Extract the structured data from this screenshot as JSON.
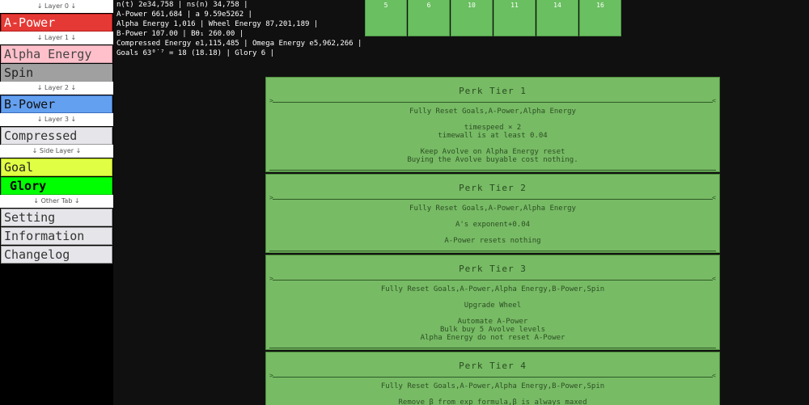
{
  "sidebar": {
    "items": [
      {
        "type": "sep",
        "label": "↓ Layer 0 ↓"
      },
      {
        "type": "tab",
        "label": "A-Power",
        "style": "red"
      },
      {
        "type": "sep",
        "label": "↓ Layer 1 ↓"
      },
      {
        "type": "tab",
        "label": "Alpha Energy",
        "style": "pink"
      },
      {
        "type": "tab",
        "label": "Spin",
        "style": "spin"
      },
      {
        "type": "sep",
        "label": "↓ Layer 2 ↓"
      },
      {
        "type": "tab",
        "label": "B-Power",
        "style": "blue"
      },
      {
        "type": "sep",
        "label": "↓ Layer 3 ↓"
      },
      {
        "type": "tab",
        "label": "Compressed",
        "style": "gray"
      },
      {
        "type": "sep",
        "label": "↓ Side Layer ↓"
      },
      {
        "type": "tab",
        "label": "Goal",
        "style": "yellow"
      },
      {
        "type": "tab",
        "label": "Glory",
        "style": "green"
      },
      {
        "type": "sep",
        "label": "↓ Other Tab ↓"
      },
      {
        "type": "tab",
        "label": "Setting",
        "style": "gray"
      },
      {
        "type": "tab",
        "label": "Information",
        "style": "gray"
      },
      {
        "type": "tab",
        "label": "Changelog",
        "style": "gray"
      }
    ]
  },
  "stats": [
    "n(t) 2e34,758 | ns(n) 34,758 |",
    "A-Power 661,684 | a 9.59e5262 |",
    "Alpha Energy 1,016 | Wheel Energy 87,201,189 |",
    "B-Power 107.00 | Bθ₁ 260.00 |",
    "Compressed Energy e1,115,485 | Omega Energy e5,962,266 |",
    "Goals 63⁰˙⁷ = 18 (18.18) | Glory 6 |"
  ],
  "top_boxes": [
    "5",
    "6",
    "10",
    "11",
    "14",
    "16"
  ],
  "perks": [
    {
      "title": "Perk Tier 1",
      "lines": [
        "Fully Reset Goals,A-Power,Alpha Energy",
        "",
        "timespeed × 2",
        "timewall is at least 0.04",
        "",
        "Keep Avolve on Alpha Energy reset",
        "Buying the Avolve buyable cost nothing."
      ]
    },
    {
      "title": "Perk Tier 2",
      "lines": [
        "Fully Reset Goals,A-Power,Alpha Energy",
        "",
        "A's exponent+0.04",
        "",
        "A-Power resets nothing"
      ]
    },
    {
      "title": "Perk Tier 3",
      "lines": [
        "Fully Reset Goals,A-Power,Alpha Energy,B-Power,Spin",
        "",
        "Upgrade Wheel",
        "",
        "Automate A-Power",
        "Bulk buy 5 Avolve levels",
        "Alpha Energy do not reset A-Power"
      ]
    },
    {
      "title": "Perk Tier 4",
      "lines": [
        "Fully Reset Goals,A-Power,Alpha Energy,B-Power,Spin",
        "",
        "Remove β from exp formula,β is always maxed"
      ]
    }
  ],
  "arrows": {
    "left": ">",
    "right": "<"
  }
}
